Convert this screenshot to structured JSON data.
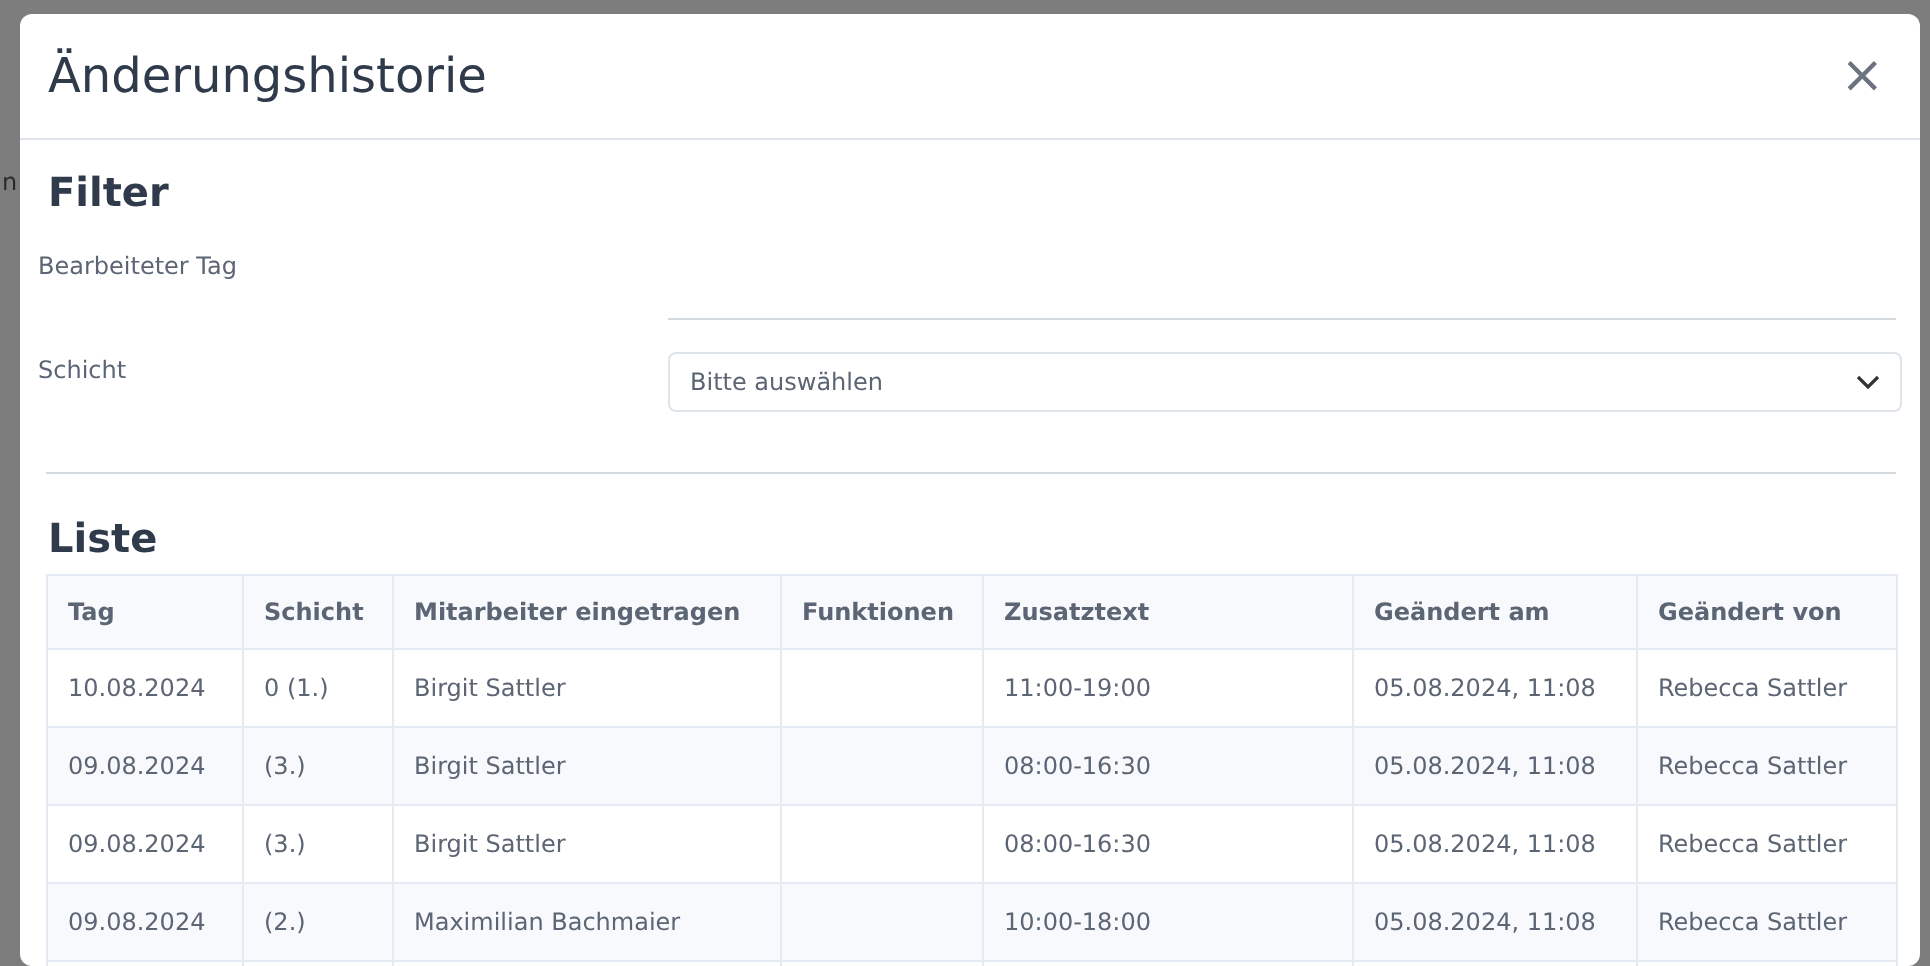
{
  "backdrop": {
    "fragments": [
      "n"
    ]
  },
  "modal": {
    "title": "Änderungshistorie",
    "close": "×"
  },
  "filter": {
    "heading": "Filter",
    "fields": [
      {
        "kind": "text",
        "label": "Bearbeiteter Tag"
      },
      {
        "kind": "select",
        "label": "Schicht",
        "placeholder": "Bitte auswählen"
      }
    ]
  },
  "list": {
    "heading": "Liste",
    "table": {
      "columns": [
        "Tag",
        "Schicht",
        "Mitarbeiter eingetragen",
        "Funktionen",
        "Zusatztext",
        "Geändert am",
        "Geändert von"
      ],
      "rows": [
        [
          "10.08.2024",
          "0 (1.)",
          "Birgit Sattler",
          "",
          "11:00-19:00",
          "05.08.2024, 11:08",
          "Rebecca Sattler"
        ],
        [
          "09.08.2024",
          "(3.)",
          "Birgit Sattler",
          "",
          "08:00-16:30",
          "05.08.2024, 11:08",
          "Rebecca Sattler"
        ],
        [
          "09.08.2024",
          "(3.)",
          "Birgit Sattler",
          "",
          "08:00-16:30",
          "05.08.2024, 11:08",
          "Rebecca Sattler"
        ],
        [
          "09.08.2024",
          "(2.)",
          "Maximilian Bachmaier",
          "",
          "10:00-18:00",
          "05.08.2024, 11:08",
          "Rebecca Sattler"
        ],
        [
          "",
          "",
          "",
          "",
          "",
          "",
          ""
        ]
      ]
    }
  }
}
